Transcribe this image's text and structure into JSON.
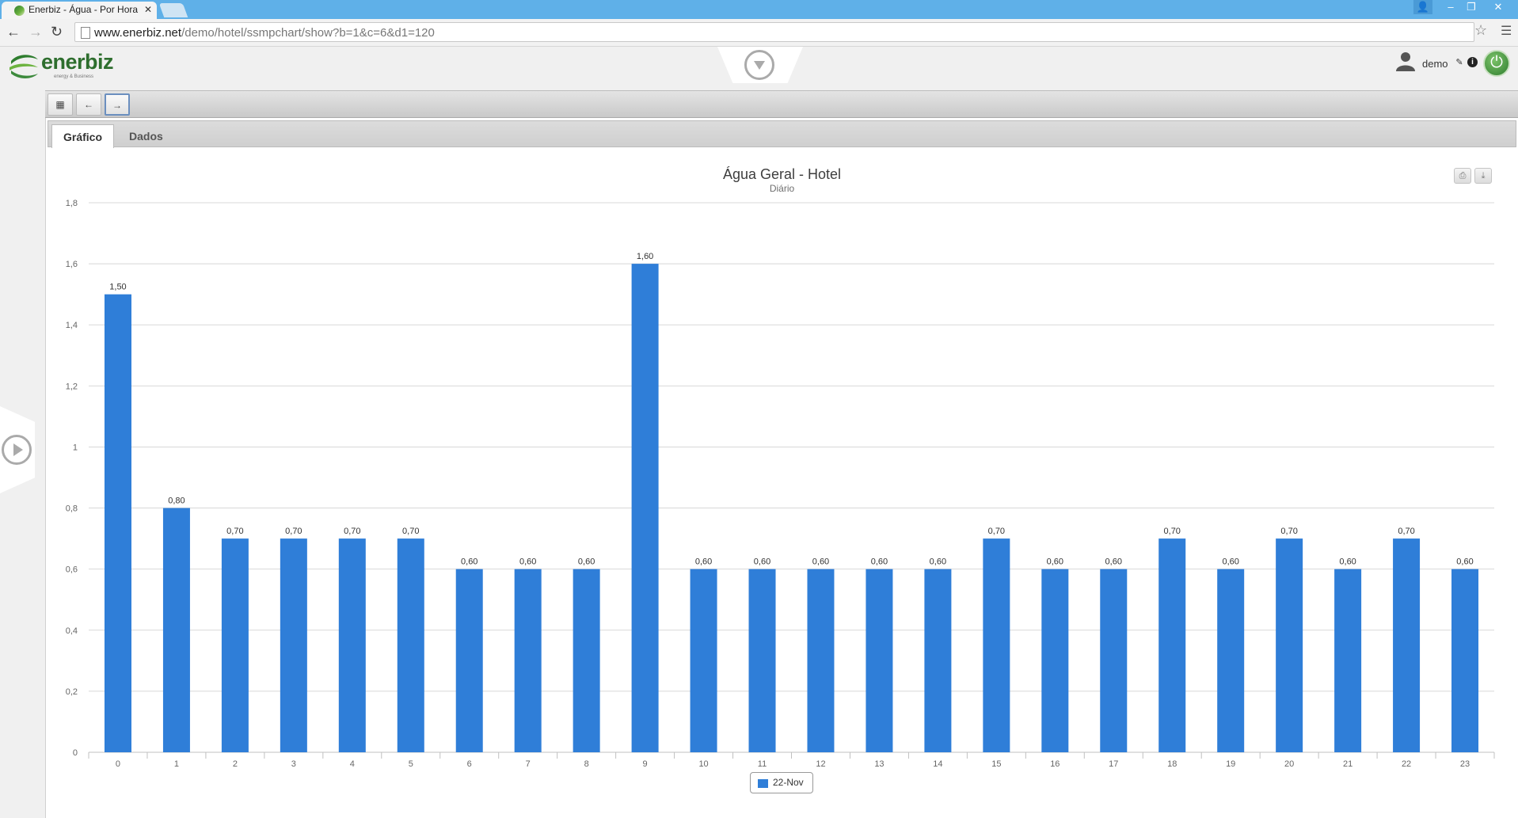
{
  "browser": {
    "tab_title": "Enerbiz - Água - Por Hora",
    "tab_close": "✕",
    "url_host": "www.enerbiz.net",
    "url_path": "/demo/hotel/ssmpchart/show?b=1&c=6&d1=120",
    "icons": [
      "page-icon",
      "star-icon",
      "menu-icon",
      "back-icon",
      "forward-icon",
      "reload-icon"
    ],
    "window_controls": {
      "user": "👤",
      "minimize": "–",
      "maximize": "❐",
      "close": "✕"
    }
  },
  "app": {
    "logo_text": "enerbiz",
    "logo_tagline": "energy & Business",
    "user_name": "demo",
    "brand_color": "#2e6e2e"
  },
  "chart_toolbar": {
    "buttons": [
      "calendar-icon",
      "arrow-left-icon",
      "arrow-right-icon"
    ],
    "glyphs": {
      "calendar": "▦",
      "prev": "←",
      "next": "→"
    }
  },
  "tabs": [
    {
      "label": "Gráfico",
      "active": true
    },
    {
      "label": "Dados",
      "active": false
    }
  ],
  "chart_data": {
    "type": "bar",
    "title": "Água Geral - Hotel",
    "subtitle": "Diário",
    "xlabel": "",
    "ylabel": "",
    "categories": [
      "0",
      "1",
      "2",
      "3",
      "4",
      "5",
      "6",
      "7",
      "8",
      "9",
      "10",
      "11",
      "12",
      "13",
      "14",
      "15",
      "16",
      "17",
      "18",
      "19",
      "20",
      "21",
      "22",
      "23"
    ],
    "series": [
      {
        "name": "22-Nov",
        "color": "#2f7ed8",
        "values": [
          1.5,
          0.8,
          0.7,
          0.7,
          0.7,
          0.7,
          0.6,
          0.6,
          0.6,
          1.6,
          0.6,
          0.6,
          0.6,
          0.6,
          0.6,
          0.7,
          0.6,
          0.6,
          0.7,
          0.6,
          0.7,
          0.6,
          0.7,
          0.6
        ],
        "data_labels": [
          "1,50",
          "0,80",
          "0,70",
          "0,70",
          "0,70",
          "0,70",
          "0,60",
          "0,60",
          "0,60",
          "1,60",
          "0,60",
          "0,60",
          "0,60",
          "0,60",
          "0,60",
          "0,70",
          "0,60",
          "0,60",
          "0,70",
          "0,60",
          "0,70",
          "0,60",
          "0,70",
          "0,60"
        ]
      }
    ],
    "ylim": [
      0,
      1.8
    ],
    "yticks": [
      0,
      0.2,
      0.4,
      0.6,
      0.8,
      1,
      1.2,
      1.4,
      1.6,
      1.8
    ],
    "ytick_labels": [
      "0",
      "0,2",
      "0,4",
      "0,6",
      "0,8",
      "1",
      "1,2",
      "1,4",
      "1,6",
      "1,8"
    ],
    "grid": true,
    "legend": "bottom-center"
  }
}
